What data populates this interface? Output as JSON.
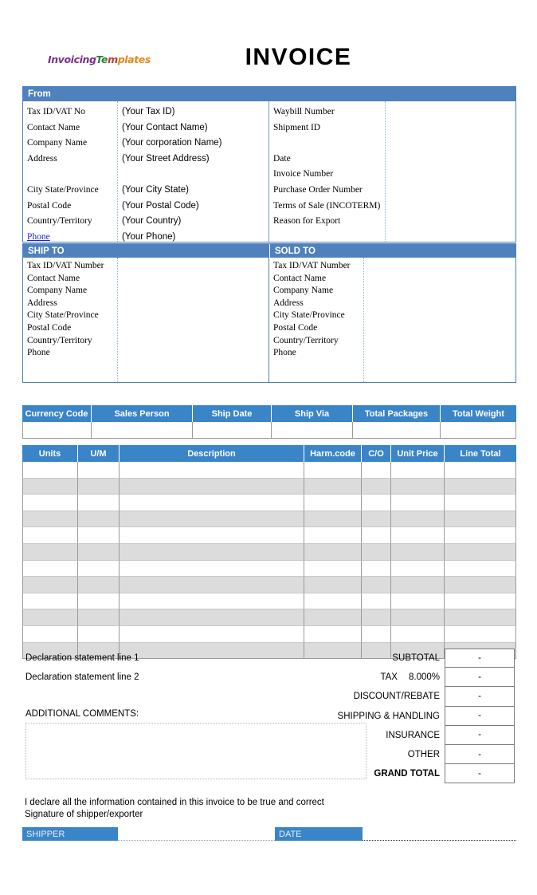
{
  "header": {
    "logo_parts": [
      {
        "text": "Invoicing",
        "color": "#7b2f8e"
      },
      {
        "text": "Te",
        "color": "#2e7d32"
      },
      {
        "text": "m",
        "color": "#c0392b"
      },
      {
        "text": "plates",
        "color": "#e08a1e"
      }
    ],
    "title": "INVOICE"
  },
  "from": {
    "band_label": "From",
    "left_rows": [
      {
        "label": "Tax ID/VAT No",
        "value": "(Your Tax ID)"
      },
      {
        "label": "Contact Name",
        "value": "(Your Contact Name)"
      },
      {
        "label": "Company Name",
        "value": "(Your corporation  Name)"
      },
      {
        "label": "Address",
        "value": "(Your Street Address)"
      },
      {
        "label": "",
        "value": ""
      },
      {
        "label": "City  State/Province",
        "value": "(Your City State)"
      },
      {
        "label": "Postal Code",
        "value": "(Your Postal Code)"
      },
      {
        "label": "Country/Territory",
        "value": "(Your Country)"
      },
      {
        "label": "Phone",
        "value": "(Your Phone)"
      }
    ],
    "right_rows": [
      {
        "label": "Waybill Number",
        "value": ""
      },
      {
        "label": "Shipment ID",
        "value": ""
      },
      {
        "label": "",
        "value": ""
      },
      {
        "label": "Date",
        "value": ""
      },
      {
        "label": "Invoice Number",
        "value": ""
      },
      {
        "label": "Purchase Order Number",
        "value": ""
      },
      {
        "label": "Terms of Sale (INCOTERM)",
        "value": ""
      },
      {
        "label": "Reason for Export",
        "value": ""
      }
    ]
  },
  "ship_sold": {
    "ship_band": "SHIP TO",
    "sold_band": "SOLD TO",
    "rows": [
      "Tax ID/VAT Number",
      "Contact Name",
      "Company Name",
      "",
      "Address",
      "",
      "City  State/Province",
      "Postal Code",
      "Country/Territory",
      "Phone"
    ]
  },
  "shipping_strip": {
    "headers": [
      "Currency Code",
      "Sales Person",
      "Ship Date",
      "Ship Via",
      "Total Packages",
      "Total Weight"
    ],
    "values": [
      "",
      "",
      "",
      "",
      "",
      ""
    ]
  },
  "line_items": {
    "headers": [
      "Units",
      "U/M",
      "Description",
      "Harm.code",
      "C/O",
      "Unit Price",
      "Line Total"
    ],
    "row_count": 12,
    "rows": []
  },
  "totals": {
    "declaration_line_1": "Declaration statement line 1",
    "declaration_line_2": "Declaration statement line 2",
    "comments_label": "ADDITIONAL COMMENTS:",
    "comments_value": "",
    "rows": [
      {
        "label": "SUBTOTAL",
        "value": "-",
        "bold": false
      },
      {
        "label": "TAX",
        "rate": "8.000%",
        "value": "-",
        "bold": false
      },
      {
        "label": "DISCOUNT/REBATE",
        "value": "-",
        "bold": false
      },
      {
        "label": "SHIPPING & HANDLING",
        "value": "-",
        "bold": false
      },
      {
        "label": "INSURANCE",
        "value": "-",
        "bold": false
      },
      {
        "label": "OTHER",
        "value": "-",
        "bold": false
      },
      {
        "label": "GRAND TOTAL",
        "value": "-",
        "bold": true
      }
    ]
  },
  "footer": {
    "declaration_text_line_1": "I declare all the information contained in this invoice to be true and correct",
    "declaration_text_line_2": "Signature of shipper/exporter",
    "shipper_label": "SHIPPER",
    "date_label": "DATE"
  },
  "colors": {
    "band_blue": "#4f81bd",
    "table_blue": "#3a85c8",
    "row_shade": "#dcdcdc",
    "link": "#2222cc"
  }
}
